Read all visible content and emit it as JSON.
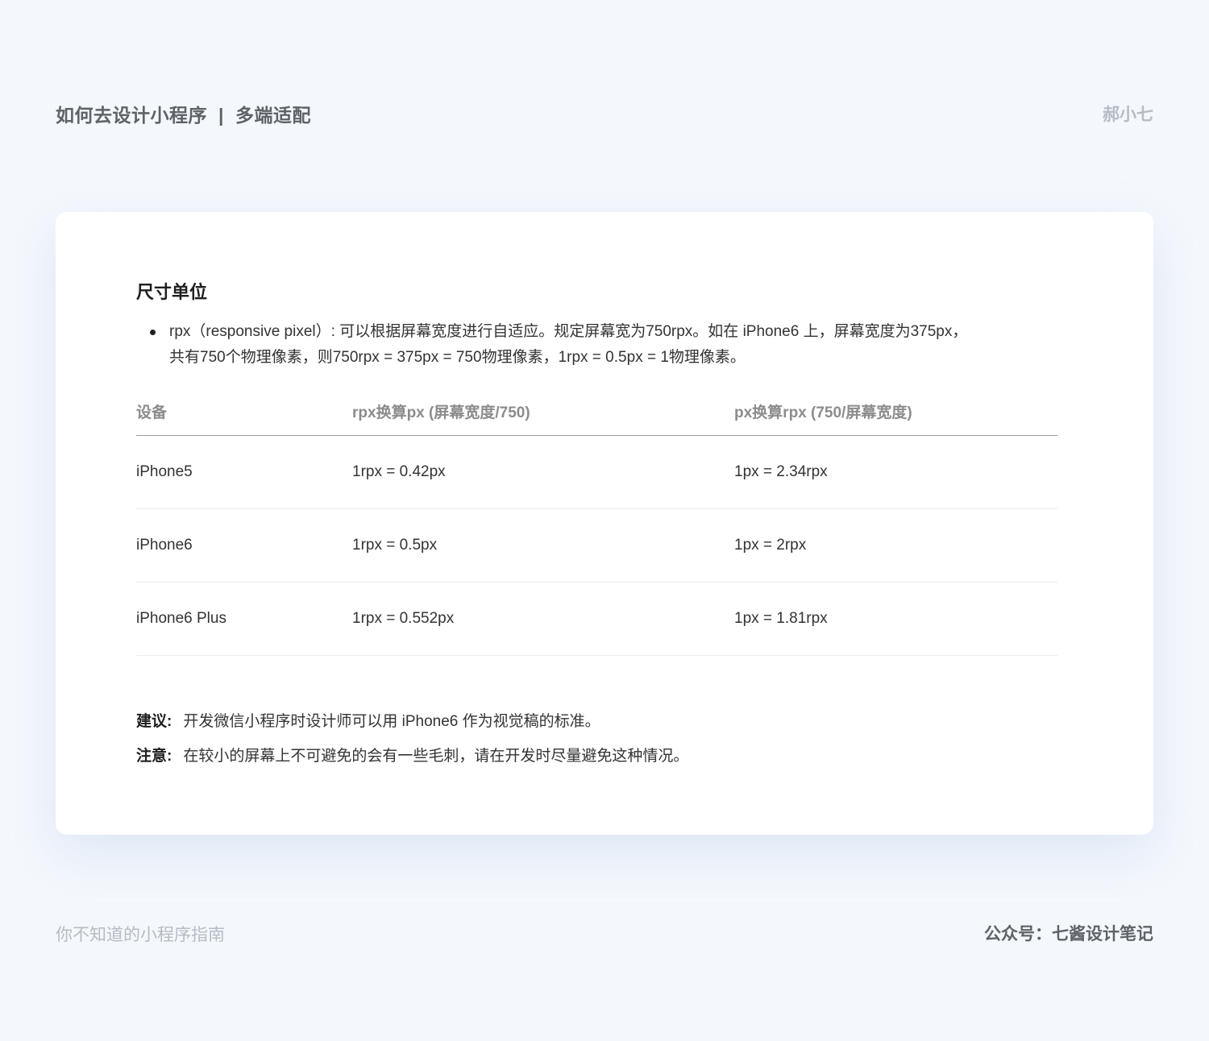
{
  "header": {
    "title_left": "如何去设计小程序",
    "separator": "|",
    "title_right": "多端适配",
    "author": "郝小七"
  },
  "card": {
    "section_title": "尺寸单位",
    "bullet_line1": "rpx（responsive pixel）: 可以根据屏幕宽度进行自适应。规定屏幕宽为750rpx。如在 iPhone6 上，屏幕宽度为375px，",
    "bullet_line2": "共有750个物理像素，则750rpx = 375px = 750物理像素，1rpx = 0.5px = 1物理像素。",
    "table": {
      "headers": [
        "设备",
        "rpx换算px (屏幕宽度/750)",
        "px换算rpx (750/屏幕宽度)"
      ],
      "rows": [
        [
          "iPhone5",
          "1rpx = 0.42px",
          "1px = 2.34rpx"
        ],
        [
          "iPhone6",
          "1rpx = 0.5px",
          "1px = 2rpx"
        ],
        [
          "iPhone6 Plus",
          "1rpx = 0.552px",
          "1px = 1.81rpx"
        ]
      ]
    },
    "notes": [
      {
        "label": "建议:",
        "text": "开发微信小程序时设计师可以用 iPhone6 作为视觉稿的标准。"
      },
      {
        "label": "注意:",
        "text": "在较小的屏幕上不可避免的会有一些毛刺，请在开发时尽量避免这种情况。"
      }
    ]
  },
  "footer": {
    "left": "你不知道的小程序指南",
    "right": "公众号：七酱设计笔记"
  }
}
